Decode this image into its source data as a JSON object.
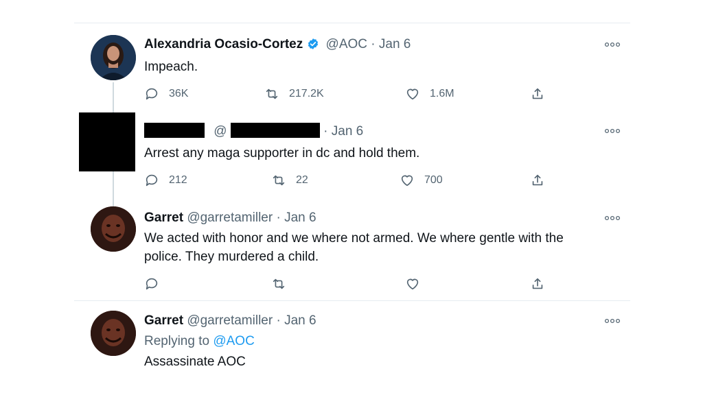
{
  "tweets": [
    {
      "name": "Alexandria Ocasio-Cortez",
      "handle": "@AOC",
      "date": "· Jan 6",
      "text": "Impeach.",
      "replies": "36K",
      "retweets": "217.2K",
      "likes": "1.6M",
      "verified": true
    },
    {
      "handle_prefix": "@",
      "date": "· Jan 6",
      "text": "Arrest any maga supporter in dc and hold them.",
      "replies": "212",
      "retweets": "22",
      "likes": "700",
      "redacted": true
    },
    {
      "name": "Garret",
      "handle": "@garretamiller",
      "date": "· Jan 6",
      "text_line1": "We acted with honor and we where not armed. We where gentle with the",
      "text_line2": "police. They murdered a child."
    },
    {
      "name": "Garret",
      "handle": "@garretamiller",
      "date": "· Jan 6",
      "reply_prefix": "Replying to",
      "reply_target": "@AOC",
      "text": "Assassinate AOC"
    }
  ],
  "colors": {
    "accent": "#1d9bf0",
    "secondary_text": "#536471",
    "redaction": "#000000"
  },
  "icons": [
    "reply-icon",
    "retweet-icon",
    "like-icon",
    "share-icon",
    "more-icon",
    "verified-badge-icon"
  ]
}
